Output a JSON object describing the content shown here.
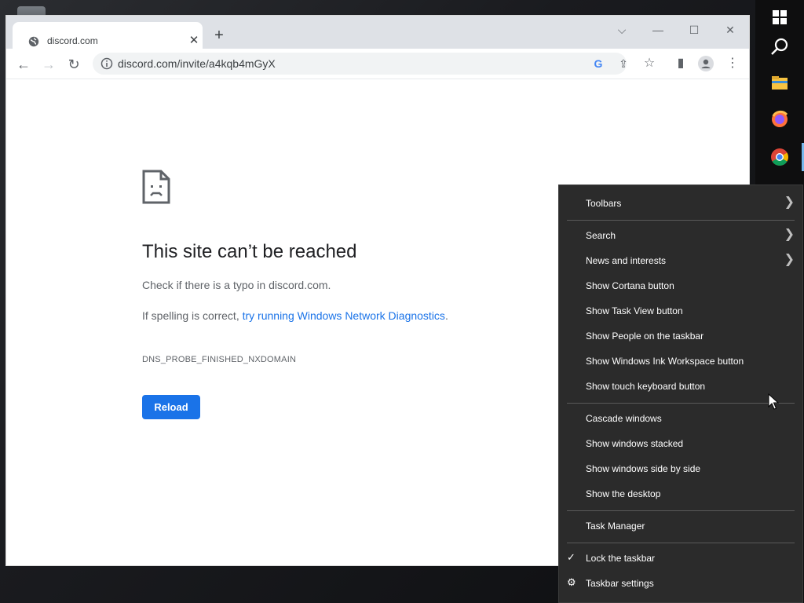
{
  "browser": {
    "tab": {
      "title": "discord.com"
    },
    "url": "discord.com/invite/a4kqb4mGyX"
  },
  "error_page": {
    "title": "This site can’t be reached",
    "line1": "Check if there is a typo in discord.com.",
    "line2_prefix": "If spelling is correct, ",
    "line2_link": "try running Windows Network Diagnostics",
    "line2_suffix": ".",
    "code": "DNS_PROBE_FINISHED_NXDOMAIN",
    "reload_label": "Reload"
  },
  "context_menu": {
    "toolbars": "Toolbars",
    "search": "Search",
    "news": "News and interests",
    "cortana": "Show Cortana button",
    "taskview": "Show Task View button",
    "people": "Show People on the taskbar",
    "ink": "Show Windows Ink Workspace button",
    "touch_keyboard": "Show touch keyboard button",
    "cascade": "Cascade windows",
    "stacked": "Show windows stacked",
    "side_by_side": "Show windows side by side",
    "desktop": "Show the desktop",
    "task_manager": "Task Manager",
    "lock": "Lock the taskbar",
    "settings": "Taskbar settings"
  },
  "colors": {
    "accent_blue": "#1a73e8",
    "menu_bg": "#2b2b2b",
    "taskbar_bg": "#0e0e0f"
  }
}
